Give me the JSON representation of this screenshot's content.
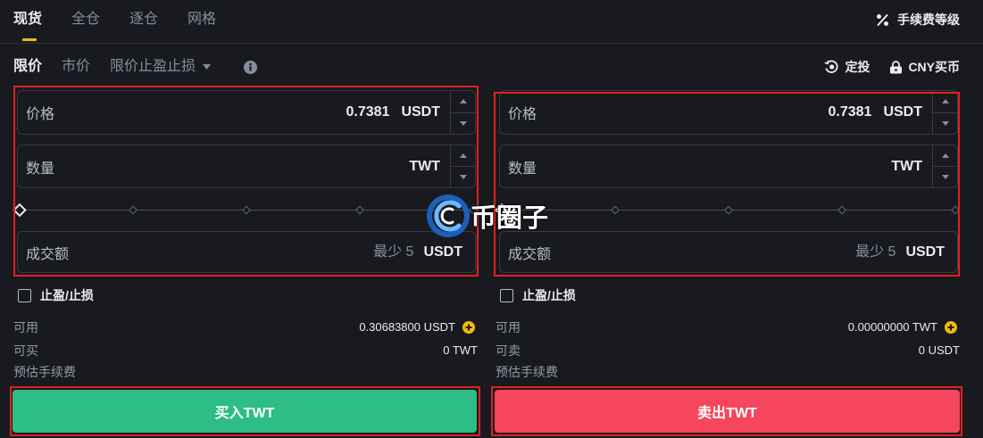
{
  "colors": {
    "accent": "#f0b90b",
    "buy": "#2ebd85",
    "sell": "#f6465d",
    "highlight": "#e0221c",
    "background": "#181a20"
  },
  "top_tabs": [
    {
      "label": "现货",
      "active": true
    },
    {
      "label": "全仓",
      "active": false
    },
    {
      "label": "逐仓",
      "active": false
    },
    {
      "label": "网格",
      "active": false
    }
  ],
  "fee_level": {
    "icon": "percent-icon",
    "label": "手续费等级"
  },
  "order_types": [
    {
      "label": "限价",
      "active": true
    },
    {
      "label": "市价",
      "active": false
    },
    {
      "label": "限价止盈止损",
      "active": false,
      "icon": "caret-down-icon"
    }
  ],
  "order_info_icon": "info-icon",
  "actions": [
    {
      "icon": "recurring-buy-icon",
      "label": "定投"
    },
    {
      "icon": "wallet-icon",
      "label": "CNY买币"
    }
  ],
  "buy": {
    "price": {
      "label": "价格",
      "value": "0.7381",
      "unit": "USDT"
    },
    "amount": {
      "label": "数量",
      "unit": "TWT"
    },
    "slider": {
      "percent": 0
    },
    "total": {
      "label": "成交额",
      "placeholder": "最少 5",
      "unit": "USDT"
    },
    "tp_sl": {
      "label": "止盈/止损",
      "checked": false
    },
    "available": {
      "label": "可用",
      "value": "0.30683800 USDT",
      "icon": "plus-circle-icon"
    },
    "max": {
      "label": "可买",
      "value": "0 TWT"
    },
    "fee": {
      "label": "预估手续费"
    },
    "submit_label": "买入TWT"
  },
  "sell": {
    "price": {
      "label": "价格",
      "value": "0.7381",
      "unit": "USDT"
    },
    "amount": {
      "label": "数量",
      "unit": "TWT"
    },
    "slider": {
      "percent": 0
    },
    "total": {
      "label": "成交额",
      "placeholder": "最少 5",
      "unit": "USDT"
    },
    "tp_sl": {
      "label": "止盈/止损",
      "checked": false
    },
    "available": {
      "label": "可用",
      "value": "0.00000000 TWT",
      "icon": "plus-circle-icon"
    },
    "max": {
      "label": "可卖",
      "value": "0 USDT"
    },
    "fee": {
      "label": "预估手续费"
    },
    "submit_label": "卖出TWT"
  },
  "watermark": {
    "text": "币圈子",
    "icon": "watermark-logo"
  }
}
